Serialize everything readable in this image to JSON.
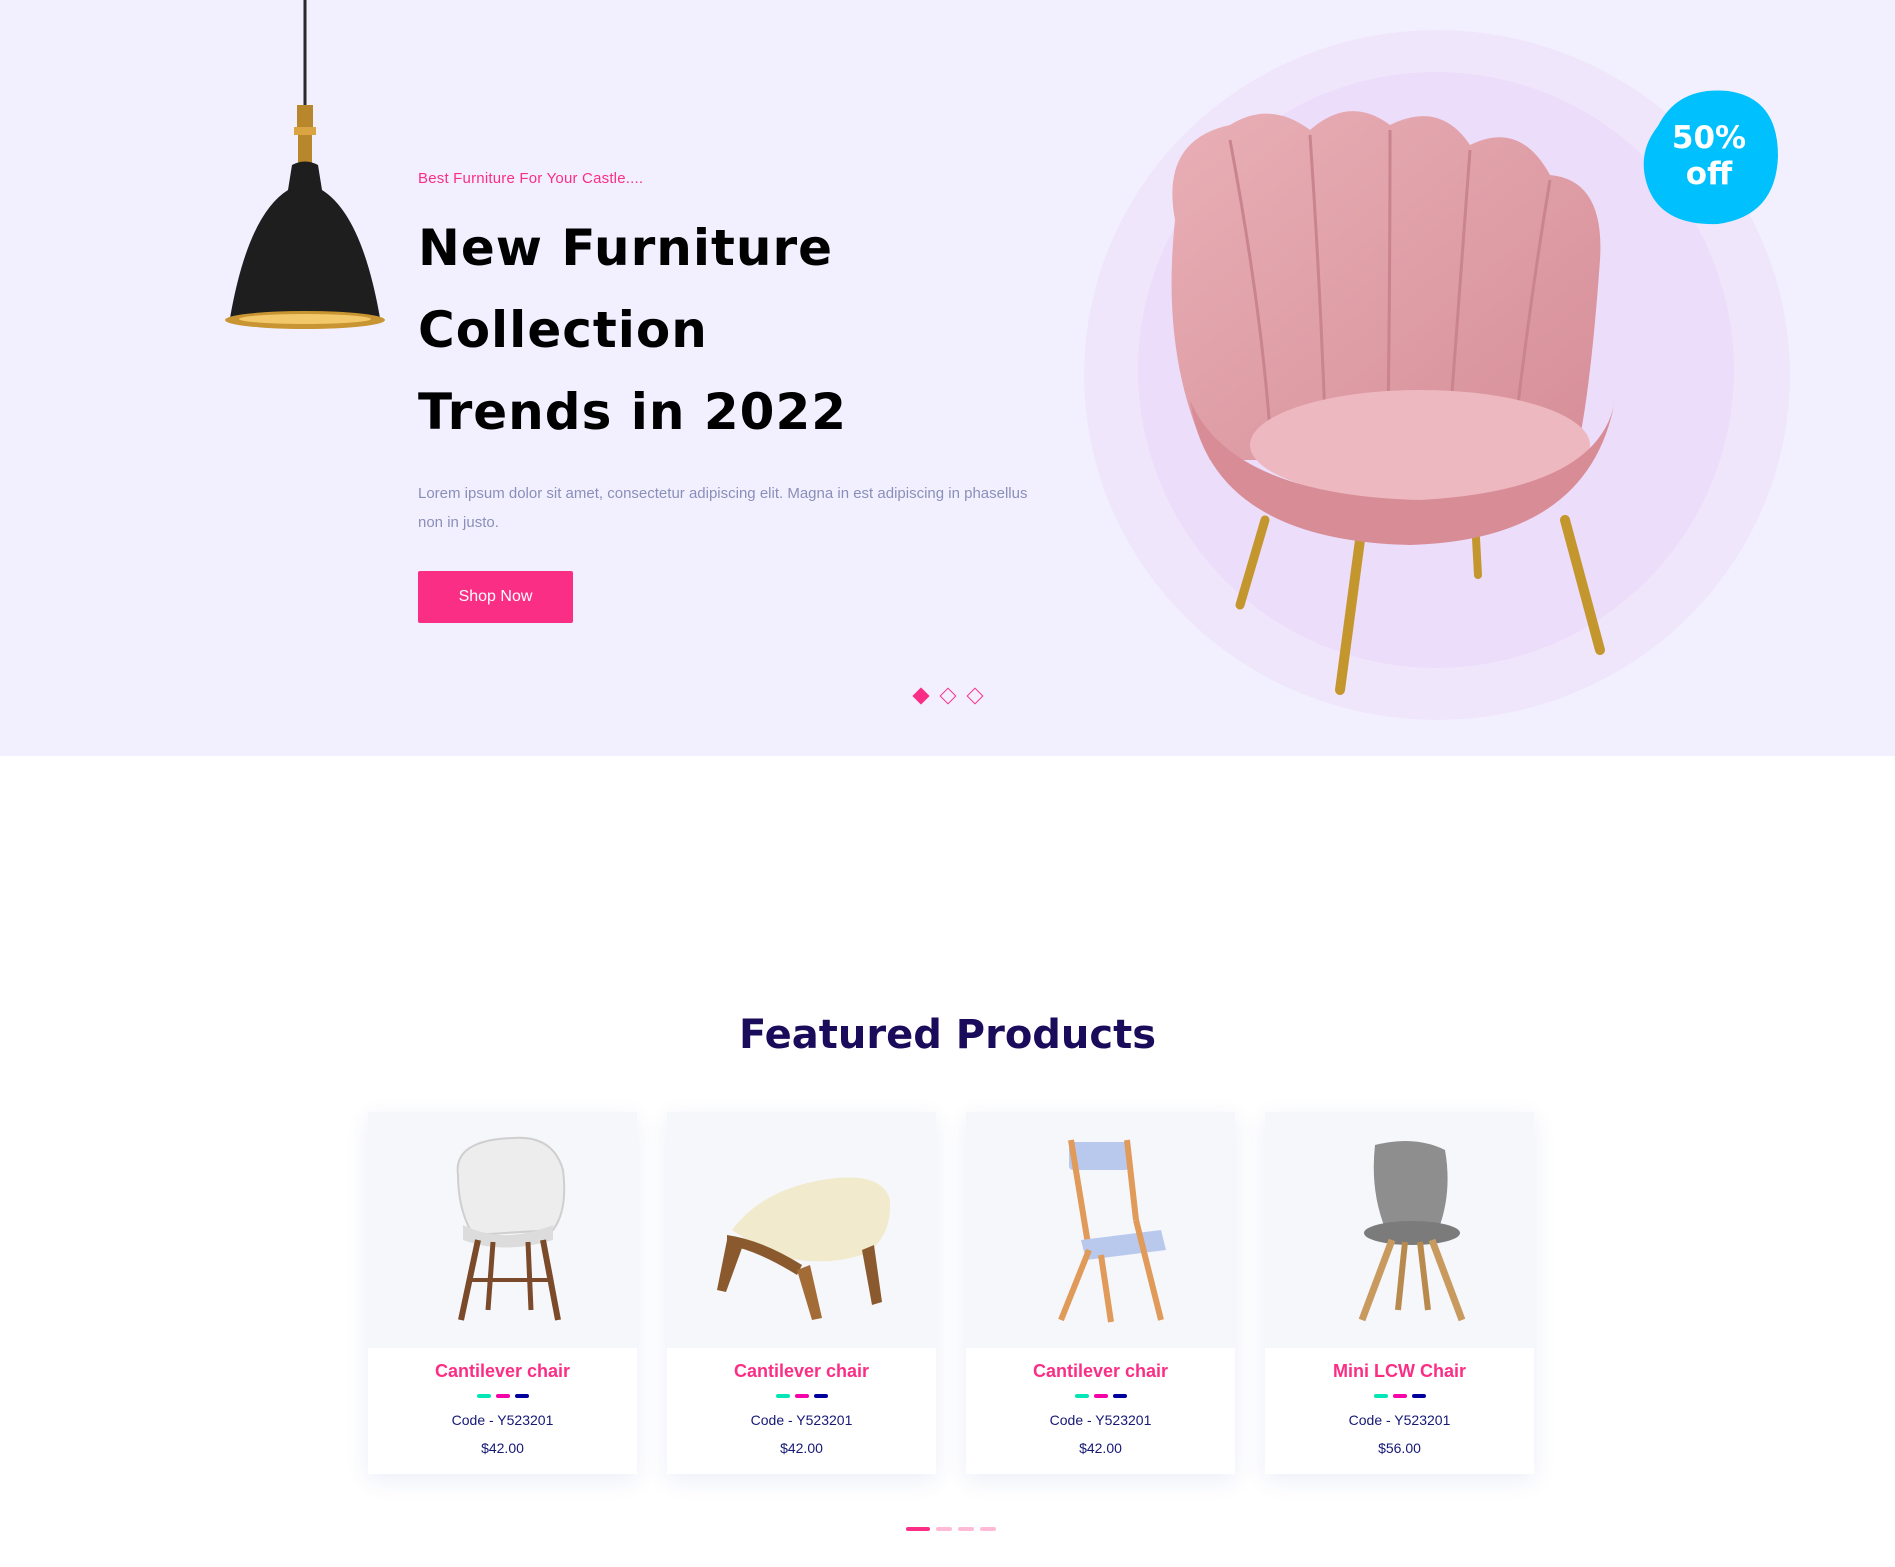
{
  "hero": {
    "tagline": "Best Furniture For Your Castle....",
    "title_line1": "New Furniture Collection",
    "title_line2": "Trends in 2022",
    "description": "Lorem ipsum dolor sit amet, consectetur adipiscing elit. Magna in est adipiscing in phasellus non in justo.",
    "cta_label": "Shop Now",
    "badge_line1": "50%",
    "badge_line2": "off",
    "slide_count": 3,
    "active_slide": 1
  },
  "featured": {
    "title": "Featured Products",
    "swatch_colors": [
      "#05E6B7",
      "#F701A8",
      "#00009D"
    ],
    "products": [
      {
        "name": "Cantilever chair",
        "code": "Code - Y523201",
        "price": "$42.00",
        "image": "white-plastic-chair"
      },
      {
        "name": "Cantilever chair",
        "code": "Code - Y523201",
        "price": "$42.00",
        "image": "wooden-lounge-chair"
      },
      {
        "name": "Cantilever chair",
        "code": "Code - Y523201",
        "price": "$42.00",
        "image": "folding-wood-chair"
      },
      {
        "name": "Mini LCW Chair",
        "code": "Code - Y523201",
        "price": "$56.00",
        "image": "grey-shell-chair"
      }
    ],
    "page_count": 4,
    "active_page": 1
  },
  "colors": {
    "accent": "#FB2E86",
    "hero_bg": "#F2F0FF",
    "heading": "#1A0B5B",
    "text": "#151875",
    "badge": "#00C1FE"
  }
}
